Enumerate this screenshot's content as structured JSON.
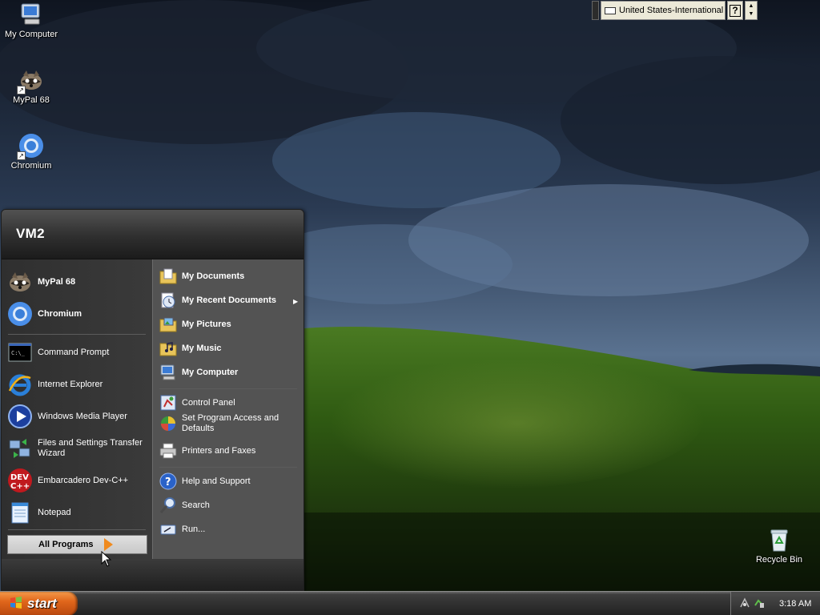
{
  "desktop": {
    "icons": [
      {
        "label": "My Computer",
        "icon": "my-computer-icon"
      },
      {
        "label": "MyPal 68",
        "icon": "mypal-icon"
      },
      {
        "label": "Chromium",
        "icon": "chromium-icon"
      },
      {
        "label": "Recycle Bin",
        "icon": "recycle-bin-icon"
      }
    ]
  },
  "language_bar": {
    "language": "United States-International",
    "help": "?"
  },
  "start_menu": {
    "user": "VM2",
    "pinned": [
      {
        "label": "MyPal 68",
        "icon": "mypal-icon"
      },
      {
        "label": "Chromium",
        "icon": "chromium-icon"
      }
    ],
    "recent": [
      {
        "label": "Command Prompt",
        "icon": "command-prompt-icon"
      },
      {
        "label": "Internet Explorer",
        "icon": "internet-explorer-icon"
      },
      {
        "label": "Windows Media Player",
        "icon": "media-player-icon"
      },
      {
        "label": "Files and Settings Transfer Wizard",
        "icon": "transfer-wizard-icon"
      },
      {
        "label": "Embarcadero Dev-C++",
        "icon": "devcpp-icon"
      },
      {
        "label": "Notepad",
        "icon": "notepad-icon"
      }
    ],
    "all_programs": "All Programs",
    "places": [
      {
        "label": "My Documents",
        "icon": "folder-documents-icon"
      },
      {
        "label": "My Recent Documents",
        "icon": "recent-documents-icon"
      },
      {
        "label": "My Pictures",
        "icon": "folder-pictures-icon"
      },
      {
        "label": "My Music",
        "icon": "folder-music-icon"
      },
      {
        "label": "My Computer",
        "icon": "my-computer-icon"
      }
    ],
    "settings": [
      {
        "label": "Control Panel",
        "icon": "control-panel-icon"
      },
      {
        "label": "Set Program Access and Defaults",
        "icon": "program-access-icon"
      },
      {
        "label": "Printers and Faxes",
        "icon": "printer-icon"
      }
    ],
    "tools": [
      {
        "label": "Help and Support",
        "icon": "help-icon"
      },
      {
        "label": "Search",
        "icon": "search-icon"
      },
      {
        "label": "Run...",
        "icon": "run-icon"
      }
    ]
  },
  "taskbar": {
    "start_label": "start",
    "clock": "3:18 AM"
  },
  "colors": {
    "start_button": "#e0661b",
    "menu_left": "#2f2f2f",
    "menu_right": "#535353",
    "taskbar": "#2e2e2e"
  }
}
